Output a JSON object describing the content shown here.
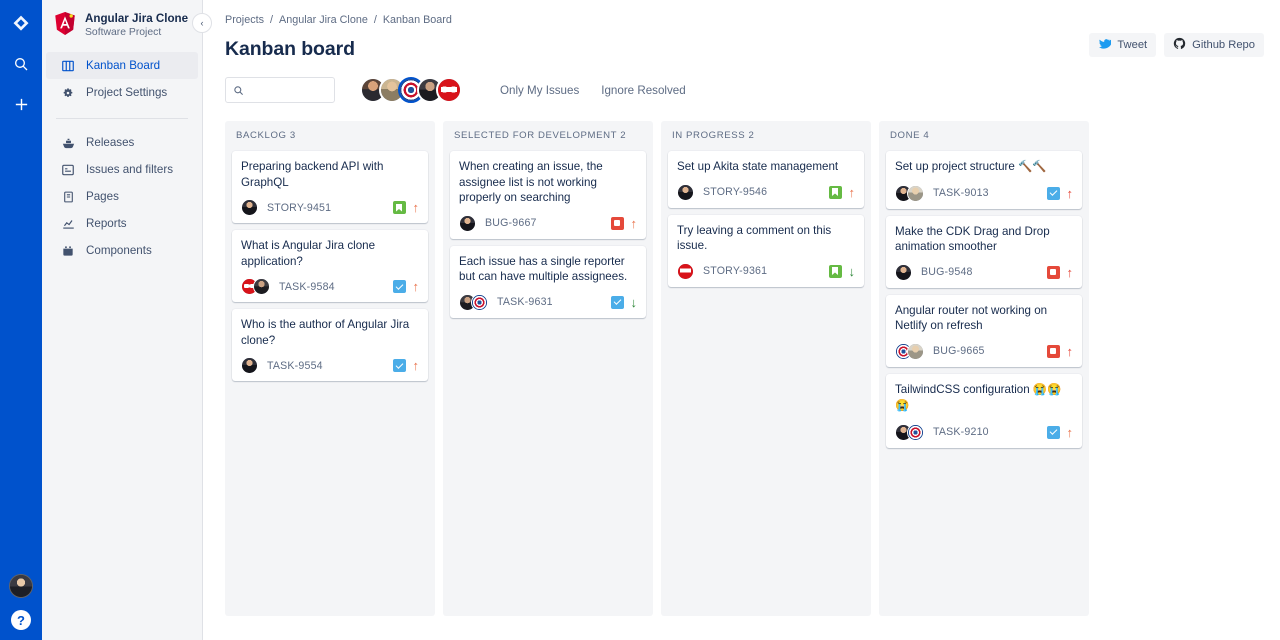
{
  "rail": {
    "logo_icon": "jira-logo-icon",
    "search_icon": "search-icon",
    "add_icon": "plus-icon",
    "help_label": "?",
    "avatar_icon": "user-avatar"
  },
  "sidebar": {
    "project_name": "Angular Jira Clone",
    "project_type": "Software Project",
    "logo_icon": "angular-logo-icon",
    "collapse_label": "‹",
    "items": [
      {
        "label": "Kanban Board",
        "icon": "board-icon",
        "active": true
      },
      {
        "label": "Project Settings",
        "icon": "gear-icon",
        "active": false
      },
      {
        "label": "Releases",
        "icon": "ship-icon",
        "active": false
      },
      {
        "label": "Issues and filters",
        "icon": "issues-icon",
        "active": false
      },
      {
        "label": "Pages",
        "icon": "page-icon",
        "active": false
      },
      {
        "label": "Reports",
        "icon": "reports-icon",
        "active": false
      },
      {
        "label": "Components",
        "icon": "components-icon",
        "active": false
      }
    ]
  },
  "breadcrumb": {
    "items": [
      "Projects",
      "Angular Jira Clone",
      "Kanban Board"
    ],
    "separator": "/"
  },
  "header": {
    "title": "Kanban board",
    "tweet_label": "Tweet",
    "tweet_icon": "twitter-icon",
    "github_label": "Github Repo",
    "github_icon": "github-icon"
  },
  "toolbar": {
    "search": {
      "value": "",
      "placeholder": "",
      "icon": "search-icon"
    },
    "avatars": [
      {
        "name": "avatar-ironman",
        "face": "ironman",
        "selected": false
      },
      {
        "name": "avatar-thor",
        "face": "thor",
        "selected": false
      },
      {
        "name": "avatar-captain-america",
        "face": "cap",
        "selected": true
      },
      {
        "name": "avatar-hulk",
        "face": "hulk",
        "selected": false
      },
      {
        "name": "avatar-spiderman",
        "face": "spider",
        "selected": false
      }
    ],
    "only_my_issues_label": "Only My Issues",
    "ignore_resolved_label": "Ignore Resolved"
  },
  "board": {
    "columns": [
      {
        "name": "backlog",
        "title": "BACKLOG",
        "count": "3",
        "cards": [
          {
            "title": "Preparing backend API with GraphQL",
            "key": "STORY-9451",
            "type": "story",
            "priority": "high",
            "priority_glyph": "↑",
            "avatars": [
              "suit"
            ]
          },
          {
            "title": "What is Angular Jira clone application?",
            "key": "TASK-9584",
            "type": "task",
            "priority": "high",
            "priority_glyph": "↑",
            "avatars": [
              "spider",
              "hulk"
            ]
          },
          {
            "title": "Who is the author of Angular Jira clone?",
            "key": "TASK-9554",
            "type": "task",
            "priority": "high",
            "priority_glyph": "↑",
            "avatars": [
              "suit"
            ]
          }
        ]
      },
      {
        "name": "selected-for-development",
        "title": "SELECTED FOR DEVELOPMENT",
        "count": "2",
        "cards": [
          {
            "title": "When creating an issue, the assignee list is not working properly on searching",
            "key": "BUG-9667",
            "type": "bug",
            "priority": "high",
            "priority_glyph": "↑",
            "avatars": [
              "suit"
            ]
          },
          {
            "title": "Each issue has a single reporter but can have multiple assignees.",
            "key": "TASK-9631",
            "type": "task",
            "priority": "low",
            "priority_glyph": "↓",
            "avatars": [
              "hulk",
              "cap"
            ]
          }
        ]
      },
      {
        "name": "in-progress",
        "title": "IN PROGRESS",
        "count": "2",
        "cards": [
          {
            "title": "Set up Akita state management",
            "key": "STORY-9546",
            "type": "story",
            "priority": "high",
            "priority_glyph": "↑",
            "avatars": [
              "suit"
            ]
          },
          {
            "title": "Try leaving a comment on this issue.",
            "key": "STORY-9361",
            "type": "story",
            "priority": "low",
            "priority_glyph": "↓",
            "avatars": [
              "spider"
            ]
          }
        ]
      },
      {
        "name": "done",
        "title": "DONE",
        "count": "4",
        "cards": [
          {
            "title": "Set up project structure",
            "emoji": "🔨🔨",
            "key": "TASK-9013",
            "type": "task",
            "priority": "highest",
            "priority_glyph": "↑",
            "avatars": [
              "suit",
              "oldman"
            ]
          },
          {
            "title": "Make the CDK Drag and Drop animation smoother",
            "key": "BUG-9548",
            "type": "bug",
            "priority": "highest",
            "priority_glyph": "↑",
            "avatars": [
              "suit"
            ]
          },
          {
            "title": "Angular router not working on Netlify on refresh",
            "key": "BUG-9665",
            "type": "bug",
            "priority": "highest",
            "priority_glyph": "↑",
            "avatars": [
              "cap",
              "oldman"
            ]
          },
          {
            "title": "TailwindCSS configuration",
            "emoji": "😭😭😭",
            "key": "TASK-9210",
            "type": "task",
            "priority": "high",
            "priority_glyph": "↑",
            "avatars": [
              "suit",
              "cap"
            ]
          }
        ]
      }
    ]
  },
  "colors": {
    "brand_blue": "#0052cc",
    "board_bg": "#f4f5f7",
    "text_dark": "#172b4d",
    "text_muted": "#5e6c84",
    "task_blue": "#4bade8",
    "story_green": "#65ba43",
    "bug_red": "#e5493a",
    "prio_high": "#e9724b",
    "prio_highest": "#e5493a",
    "prio_low": "#2d8738"
  }
}
